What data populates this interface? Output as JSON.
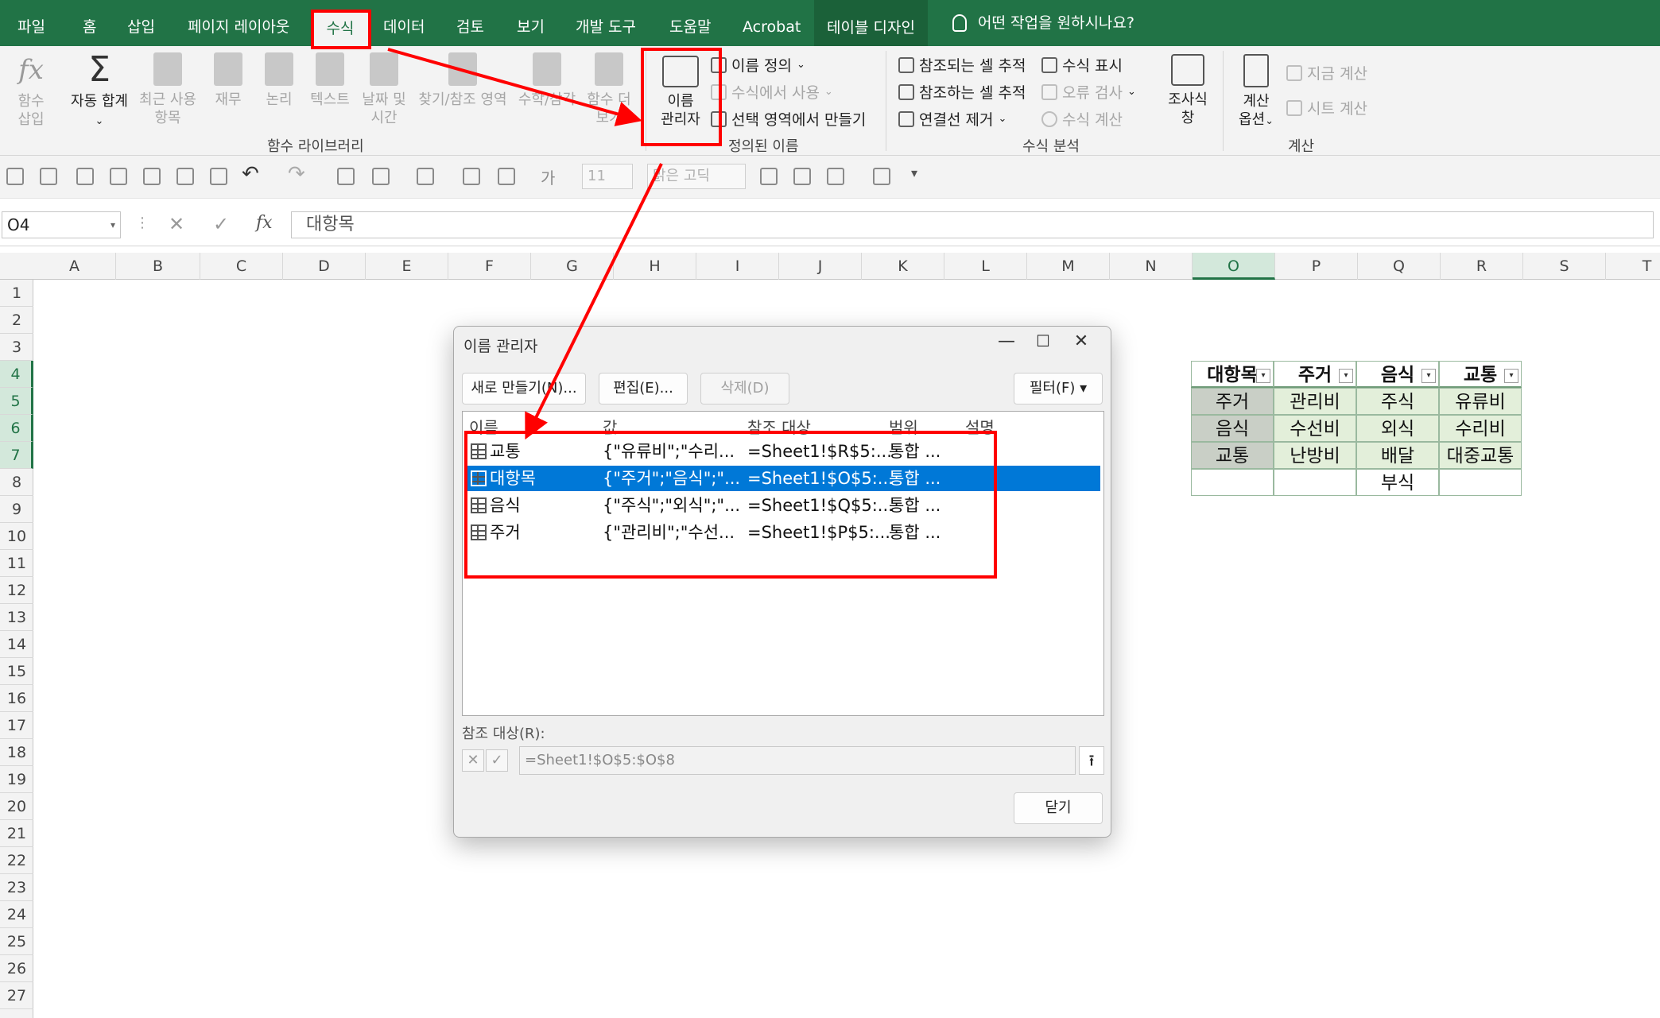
{
  "ribbon_tabs": {
    "file": "파일",
    "home": "홈",
    "insert": "삽입",
    "page_layout": "페이지 레이아웃",
    "formulas": "수식",
    "data": "데이터",
    "review": "검토",
    "view": "보기",
    "developer": "개발 도구",
    "help": "도움말",
    "acrobat": "Acrobat",
    "table_design": "테이블 디자인",
    "search": "어떤 작업을 원하시나요?"
  },
  "ribbon": {
    "insert_function": [
      "함수",
      "삽입"
    ],
    "autosum": "자동 합계",
    "recent": [
      "최근 사용",
      "항목"
    ],
    "financial": "재무",
    "logical": "논리",
    "text": "텍스트",
    "datetime": [
      "날짜 및",
      "시간"
    ],
    "lookup": "찾기/참조 영역",
    "math": "수학/삼각",
    "more": [
      "함수 더",
      "보기"
    ],
    "group_function_library": "함수 라이브러리",
    "name_manager": [
      "이름",
      "관리자"
    ],
    "define_name": "이름 정의",
    "use_in_formula": "수식에서 사용",
    "create_from_selection": "선택 영역에서 만들기",
    "group_defined_names": "정의된 이름",
    "trace_precedents": "참조되는 셀 추적",
    "trace_dependents": "참조하는 셀 추적",
    "remove_arrows": "연결선 제거",
    "show_formulas": "수식 표시",
    "error_checking": "오류 검사",
    "evaluate_formula": "수식 계산",
    "watch_window": [
      "조사식",
      "창"
    ],
    "group_formula_auditing": "수식 분석",
    "calc_options": [
      "계산",
      "옵션"
    ],
    "calc_now": "지금 계산",
    "calc_sheet": "시트 계산",
    "group_calculation": "계산"
  },
  "qat": {
    "font_size": "11",
    "font_name": "맑은 고딕",
    "cell_style": "가"
  },
  "formula_bar": {
    "name_box": "O4",
    "content": "대항목"
  },
  "columns": [
    "A",
    "B",
    "C",
    "D",
    "E",
    "F",
    "G",
    "H",
    "I",
    "J",
    "K",
    "L",
    "M",
    "N",
    "O",
    "P",
    "Q",
    "R",
    "S",
    "T"
  ],
  "rows": [
    "1",
    "2",
    "3",
    "4",
    "5",
    "6",
    "7",
    "8",
    "9",
    "10",
    "11",
    "12",
    "13",
    "14",
    "15",
    "16",
    "17",
    "18",
    "19",
    "20",
    "21",
    "22",
    "23",
    "24",
    "25",
    "26",
    "27"
  ],
  "sheet_table": {
    "headers": [
      "대항목",
      "주거",
      "음식",
      "교통"
    ],
    "rows": [
      [
        "주거",
        "관리비",
        "주식",
        "유류비"
      ],
      [
        "음식",
        "수선비",
        "외식",
        "수리비"
      ],
      [
        "교통",
        "난방비",
        "배달",
        "대중교통"
      ],
      [
        "",
        "",
        "부식",
        ""
      ]
    ]
  },
  "dialog": {
    "title": "이름 관리자",
    "new_button": "새로 만들기(N)...",
    "edit_button": "편집(E)...",
    "delete_button": "삭제(D)",
    "filter_button": "필터(F)",
    "columns": [
      "이름",
      "값",
      "참조 대상",
      "범위",
      "설명"
    ],
    "rows": [
      {
        "name": "교통",
        "value": "{\"유류비\";\"수리...",
        "refers_to": "=Sheet1!$R$5:...",
        "scope": "통합 ..."
      },
      {
        "name": "대항목",
        "value": "{\"주거\";\"음식\";\"...",
        "refers_to": "=Sheet1!$O$5:...",
        "scope": "통합 ..."
      },
      {
        "name": "음식",
        "value": "{\"주식\";\"외식\";\"...",
        "refers_to": "=Sheet1!$Q$5:...",
        "scope": "통합 ..."
      },
      {
        "name": "주거",
        "value": "{\"관리비\";\"수선...",
        "refers_to": "=Sheet1!$P$5:...",
        "scope": "통합 ..."
      }
    ],
    "selected_row": 1,
    "refers_to_label": "참조 대상(R):",
    "refers_to_value": "=Sheet1!$O$5:$O$8",
    "close_button": "닫기"
  },
  "annotation_color": "#ff0000"
}
